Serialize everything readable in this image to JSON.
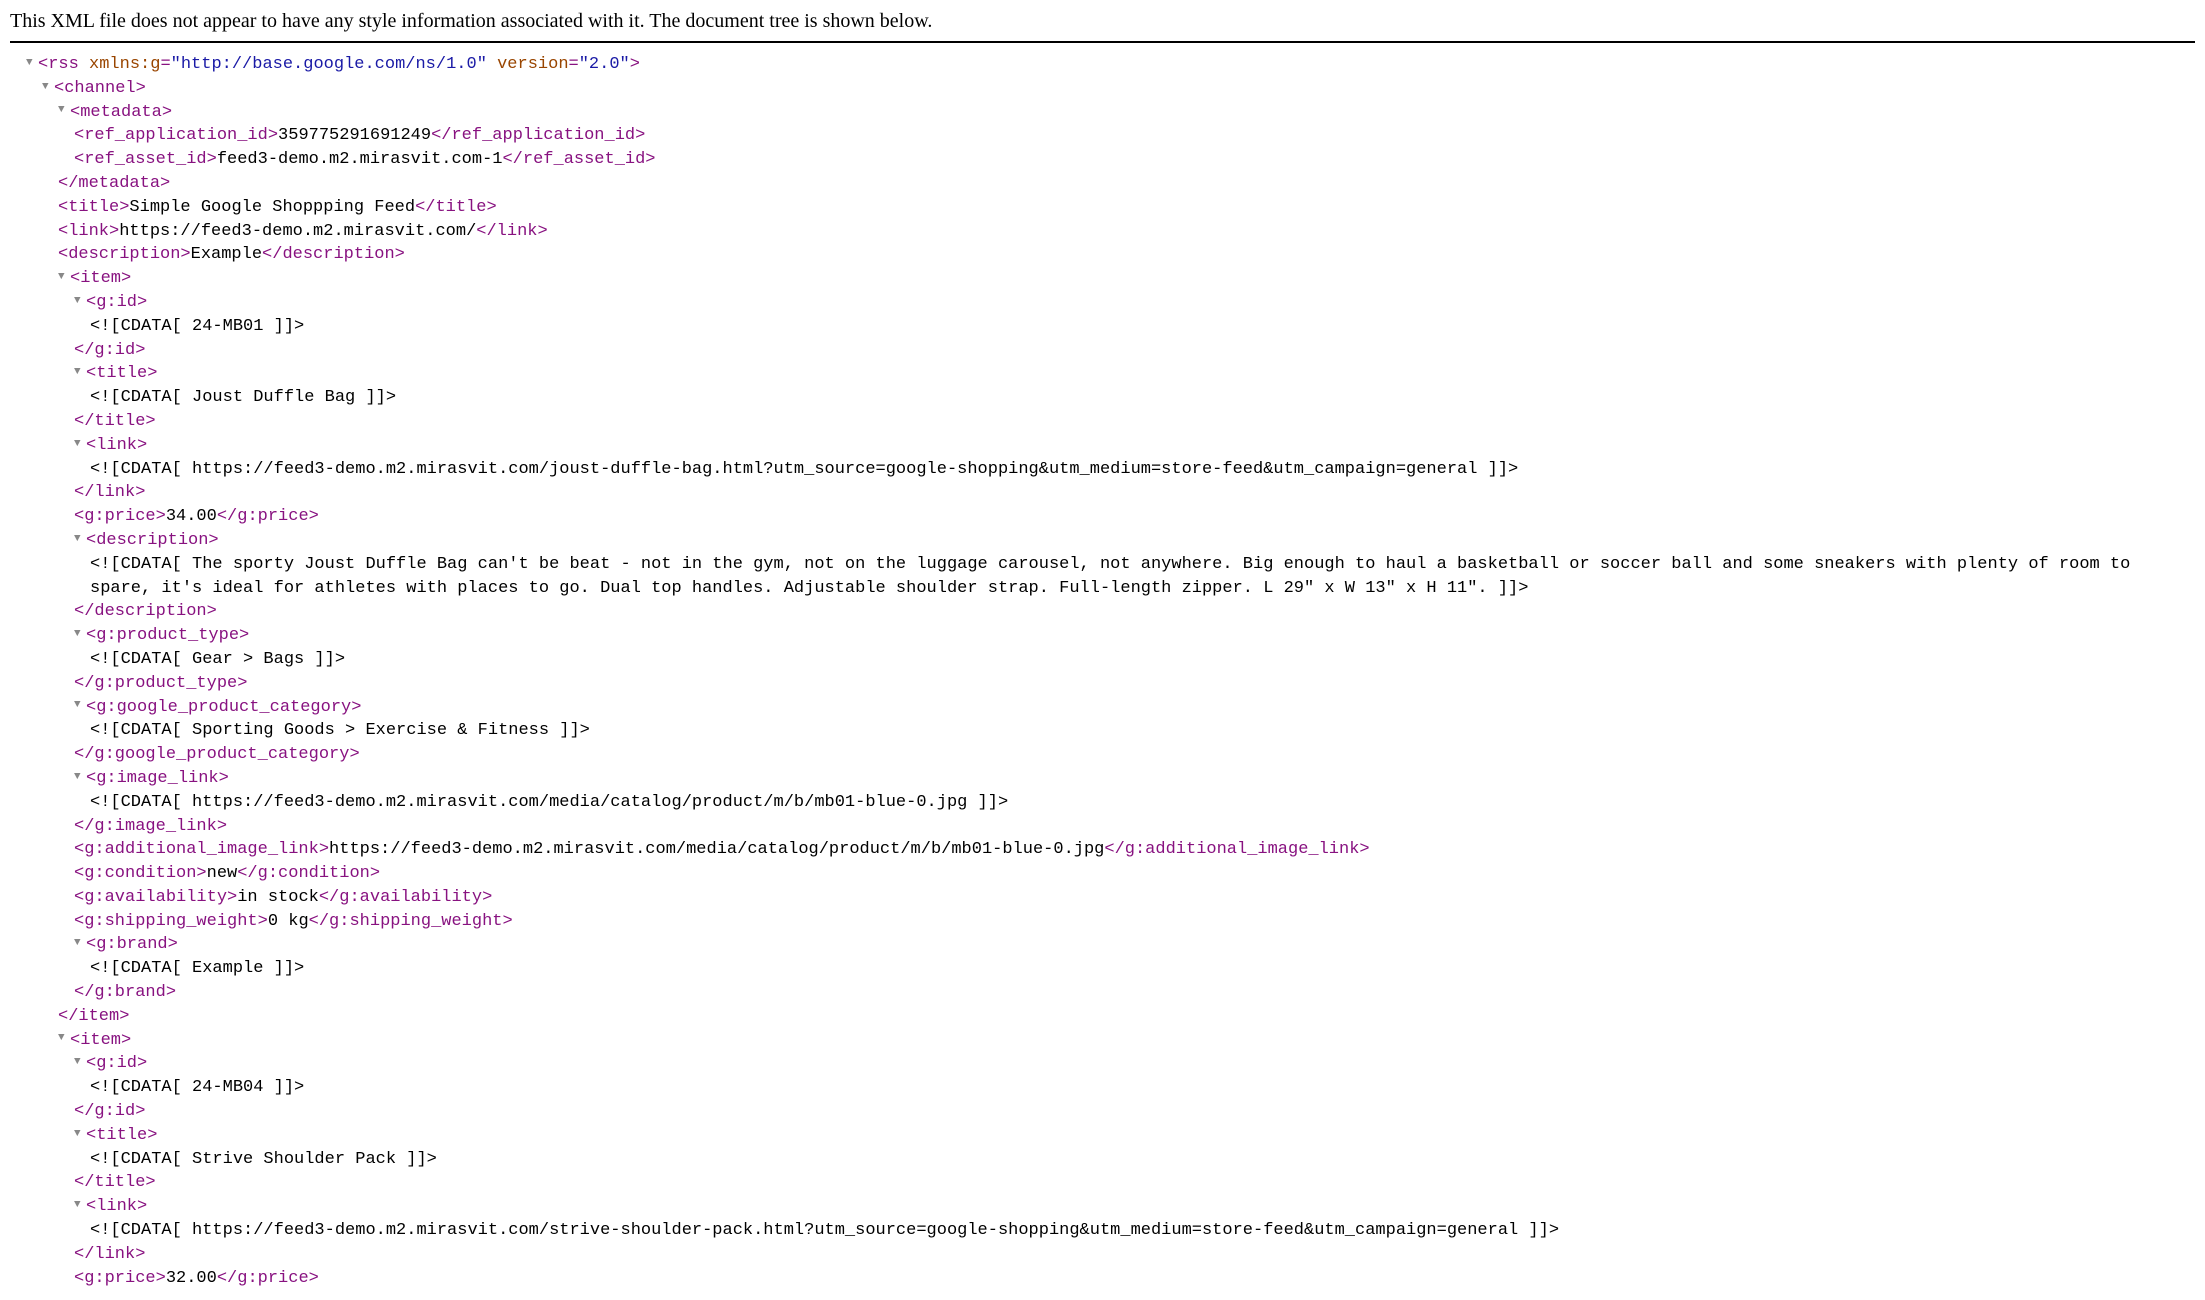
{
  "notice": "This XML file does not appear to have any style information associated with it. The document tree is shown below.",
  "rss": {
    "xmlns_g_name": "xmlns:g",
    "xmlns_g_value": "\"http://base.google.com/ns/1.0\"",
    "version_name": "version",
    "version_value": "\"2.0\""
  },
  "metadata": {
    "ref_app_id": "359775291691249",
    "ref_asset_id": "feed3-demo.m2.mirasvit.com-1"
  },
  "channel": {
    "title": "Simple Google Shoppping Feed",
    "link": "https://feed3-demo.m2.mirasvit.com/",
    "description": "Example"
  },
  "item1": {
    "gid": "<![CDATA[ 24-MB01 ]]>",
    "title": "<![CDATA[ Joust Duffle Bag ]]>",
    "link": "<![CDATA[ https://feed3-demo.m2.mirasvit.com/joust-duffle-bag.html?utm_source=google-shopping&utm_medium=store-feed&utm_campaign=general ]]>",
    "price": "34.00",
    "desc": "<![CDATA[ The sporty Joust Duffle Bag can't be beat - not in the gym, not on the luggage carousel, not anywhere. Big enough to haul a basketball or soccer ball and some sneakers with plenty of room to spare, it's ideal for athletes with places to go. Dual top handles. Adjustable shoulder strap. Full-length zipper. L 29\" x W 13\" x H 11\". ]]>",
    "product_type": "<![CDATA[ Gear > Bags ]]>",
    "google_cat": "<![CDATA[ Sporting Goods > Exercise & Fitness ]]>",
    "image_link": "<![CDATA[ https://feed3-demo.m2.mirasvit.com/media/catalog/product/m/b/mb01-blue-0.jpg ]]>",
    "add_image": "https://feed3-demo.m2.mirasvit.com/media/catalog/product/m/b/mb01-blue-0.jpg",
    "condition": "new",
    "availability": "in stock",
    "shipping_weight": "0 kg",
    "brand": "<![CDATA[ Example ]]>"
  },
  "item2": {
    "gid": "<![CDATA[ 24-MB04 ]]>",
    "title": "<![CDATA[ Strive Shoulder Pack ]]>",
    "link": "<![CDATA[ https://feed3-demo.m2.mirasvit.com/strive-shoulder-pack.html?utm_source=google-shopping&utm_medium=store-feed&utm_campaign=general ]]>",
    "price": "32.00"
  }
}
